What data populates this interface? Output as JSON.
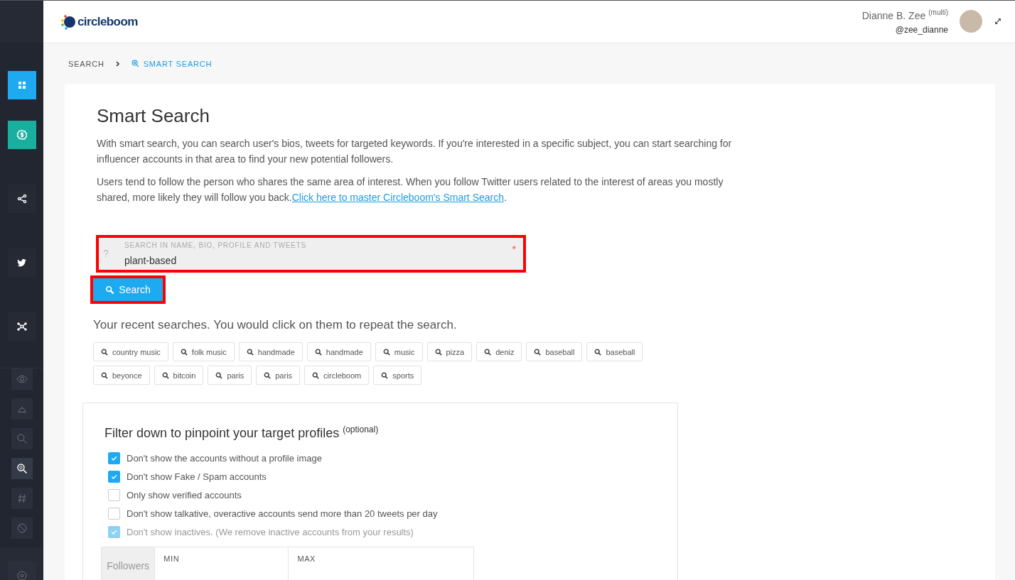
{
  "sidebar": {
    "buttons": [
      {
        "color": "#1eaaf1"
      },
      {
        "color": "#1aae9f"
      },
      {
        "color": "#262a35"
      },
      {
        "color": "#262a35"
      },
      {
        "color": "#262a35"
      }
    ],
    "tools": [
      {
        "selected": false
      },
      {
        "selected": false
      },
      {
        "selected": false
      },
      {
        "selected": true
      },
      {
        "selected": false
      },
      {
        "selected": false
      }
    ]
  },
  "header": {
    "logo": "circleboom",
    "user_name": "Dianne B. Zee",
    "user_tag": "(multi)",
    "handle": "@zee_dianne"
  },
  "breadcrumb": [
    {
      "label": "SEARCH",
      "selected": false
    },
    {
      "label": "SMART SEARCH",
      "selected": true
    }
  ],
  "page": {
    "title": "Smart Search",
    "paragraphs": [
      {
        "text": "With smart search, you can search user's bios, tweets for targeted keywords. If you're interested in a specific subject, you can start searching for influencer accounts in that area to find your new potential followers."
      },
      {
        "text": "Users tend to follow the person who shares the same area of interest. When you follow Twitter users related to the interest of areas you mostly shared, more likely they will follow you back.",
        "link": "Click here to master Circleboom's Smart Search",
        "after": "."
      }
    ],
    "search_field": {
      "help": "?",
      "label": "SEARCH IN NAME, BIO, PROFILE AND TWEETS",
      "value": "plant-based",
      "required": "*"
    },
    "search_button": "Search",
    "recent_title": "Your recent searches. You would click on them to repeat the search.",
    "recent": [
      "country music",
      "folk music",
      "handmade",
      "handmade",
      "music",
      "pizza",
      "deniz",
      "baseball",
      "baseball",
      "beyonce",
      "bitcoin",
      "paris",
      "paris",
      "circleboom",
      "sports"
    ]
  },
  "filters": {
    "title": "Filter down to pinpoint your target profiles",
    "title_note": "(optional)",
    "options": [
      {
        "label": "Don't show the accounts without a profile image",
        "checked": true,
        "disabled": false
      },
      {
        "label": "Don't show Fake / Spam accounts",
        "checked": true,
        "disabled": false
      },
      {
        "label": "Only show verified accounts",
        "checked": false,
        "disabled": false
      },
      {
        "label": "Don't show talkative, overactive accounts send more than 20 tweets per day",
        "checked": false,
        "disabled": false
      },
      {
        "label": "Don't show inactives. (We remove inactive accounts from your results)",
        "checked": true,
        "disabled": true
      }
    ],
    "range": {
      "label": "Followers",
      "min_label": "MIN",
      "max_label": "MAX"
    }
  }
}
